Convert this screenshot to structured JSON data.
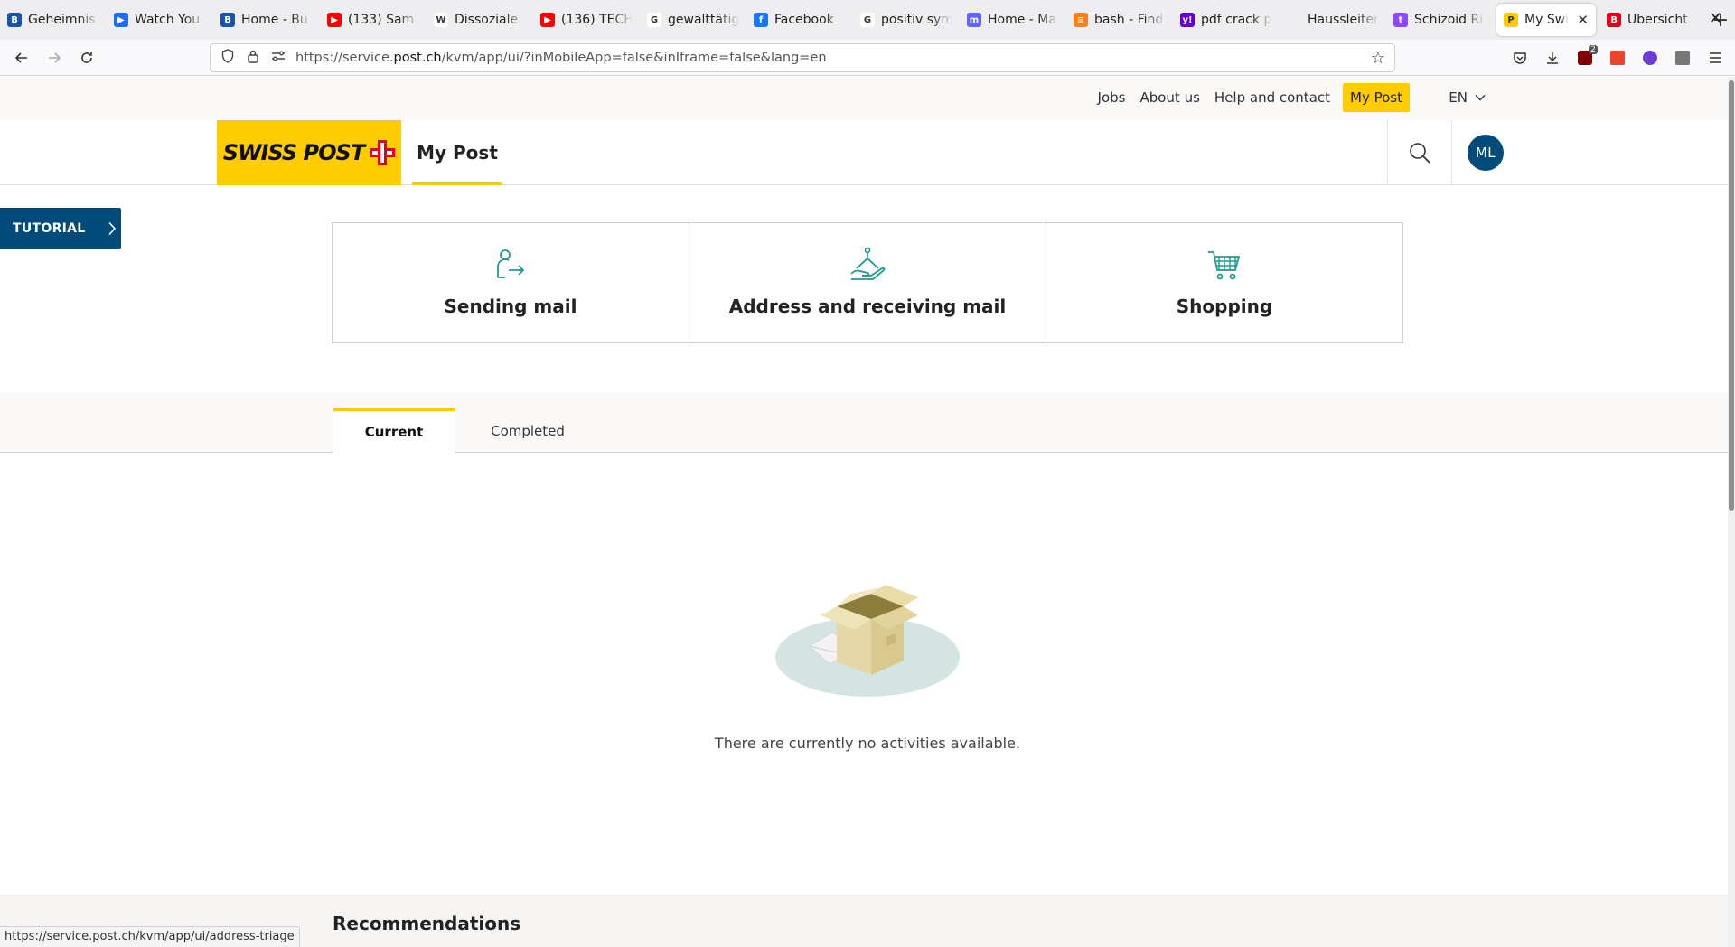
{
  "browser": {
    "tabs": [
      {
        "title": "Geheimnis",
        "favicon_letter": "B",
        "favicon_color": "#1a55a8"
      },
      {
        "title": "Watch You",
        "favicon_letter": "▶",
        "favicon_color": "#1e6cf2"
      },
      {
        "title": "Home - Bu",
        "favicon_letter": "B",
        "favicon_color": "#1a55a8"
      },
      {
        "title": "(133) Sam",
        "favicon_letter": "▶",
        "favicon_color": "#ff0000"
      },
      {
        "title": "Dissoziale",
        "favicon_letter": "W",
        "favicon_color": "#ffffff"
      },
      {
        "title": "(136) TECH",
        "favicon_letter": "▶",
        "favicon_color": "#ff0000"
      },
      {
        "title": "gewalttätig",
        "favicon_letter": "G",
        "favicon_color": "#ffffff"
      },
      {
        "title": "Facebook",
        "favicon_letter": "f",
        "favicon_color": "#1877f2"
      },
      {
        "title": "positiv sym",
        "favicon_letter": "G",
        "favicon_color": "#ffffff"
      },
      {
        "title": "Home - Ma",
        "favicon_letter": "m",
        "favicon_color": "#6364ff"
      },
      {
        "title": "bash - Find",
        "favicon_letter": "≡",
        "favicon_color": "#f48024"
      },
      {
        "title": "pdf crack p",
        "favicon_letter": "y!",
        "favicon_color": "#6001d2"
      },
      {
        "title": "Haussleiter, D",
        "favicon_letter": "",
        "favicon_color": "#eeeef0"
      },
      {
        "title": "Schizoid Ri",
        "favicon_letter": "t",
        "favicon_color": "#9146ff"
      },
      {
        "title": "My Swiss",
        "favicon_letter": "P",
        "favicon_color": "#ffcc00"
      },
      {
        "title": "Übersicht",
        "favicon_letter": "B",
        "favicon_color": "#e2001a"
      }
    ],
    "active_tab_index": 14,
    "url_prefix": "https://service.",
    "url_domain": "post.ch",
    "url_suffix": "/kvm/app/ui/?inMobileApp=false&inIframe=false&lang=en",
    "status_url": "https://service.post.ch/kvm/app/ui/address-triage",
    "extension_badge": "2"
  },
  "meta_nav": {
    "links": [
      "Jobs",
      "About us",
      "Help and contact"
    ],
    "my_post": "My Post",
    "language": "EN"
  },
  "header": {
    "logo_text": "SWISS POST",
    "title": "My Post",
    "avatar_initials": "ML"
  },
  "tutorial": {
    "label": "TUTORIAL"
  },
  "tiles": [
    {
      "label": "Sending mail",
      "icon": "person-send-icon"
    },
    {
      "label": "Address and receiving mail",
      "icon": "house-hand-icon"
    },
    {
      "label": "Shopping",
      "icon": "shopping-cart-icon"
    }
  ],
  "activity_tabs": {
    "current": "Current",
    "completed": "Completed"
  },
  "empty_state": {
    "text": "There are currently no activities available."
  },
  "recommendations": {
    "title": "Recommendations"
  },
  "colors": {
    "brand_yellow": "#ffcc00",
    "brand_blue": "#004b7a",
    "icon_teal": "#1f9a8f",
    "swiss_red": "#e2001a"
  }
}
